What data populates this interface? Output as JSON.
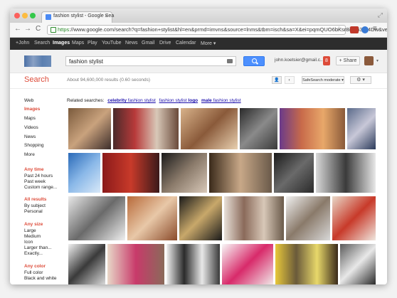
{
  "browser": {
    "tab_title": "fashion stylist - Google Sea",
    "tab_close": "×",
    "url_https": "https",
    "url_rest": "://www.google.com/search?q=fashion+stylist&hl=en&prmd=imvns&source=lnms&tbm=isch&sa=X&ei=pqmQUO6bKsr8igK63IH4Dw&ved=0C",
    "back": "←",
    "forward": "→",
    "reload": "C",
    "star": "☆",
    "menu": "≡"
  },
  "gbar": {
    "items": [
      "+John",
      "Search",
      "Images",
      "Maps",
      "Play",
      "YouTube",
      "News",
      "Gmail",
      "Drive",
      "Calendar",
      "More ▾"
    ]
  },
  "header": {
    "query": "fashion stylist",
    "account": "john.koetsier@gmail.c...",
    "notifications": "8",
    "share": "+ Share"
  },
  "results": {
    "label": "Search",
    "count": "About 94,600,000 results (0.60 seconds)",
    "safesearch": "SafeSearch moderate ▾",
    "settings": "⚙ ▾"
  },
  "sidebar": {
    "types": [
      "Web",
      "Images",
      "Maps",
      "Videos",
      "News",
      "Shopping",
      "More"
    ],
    "any_time": "Any time",
    "time_opts": [
      "Past 24 hours",
      "Past week",
      "Custom range..."
    ],
    "all_results": "All results",
    "result_opts": [
      "By subject",
      "Personal"
    ],
    "any_size": "Any size",
    "size_opts": [
      "Large",
      "Medium",
      "Icon",
      "Larger than...",
      "Exactly..."
    ],
    "any_color": "Any color",
    "color_opts": [
      "Full color",
      "Black and white"
    ]
  },
  "related": {
    "label": "Related searches:",
    "links": [
      {
        "bold": "celebrity",
        "rest": " fashion stylist"
      },
      {
        "bold": "",
        "rest": "fashion stylist ",
        "bold2": "logo"
      },
      {
        "bold": "male",
        "rest": " fashion stylist"
      }
    ]
  },
  "colors": {
    "accent": "#dd4b39",
    "link": "#1a0dab",
    "gbar": "#2d2d2d",
    "search_button": "#4d90fe"
  }
}
